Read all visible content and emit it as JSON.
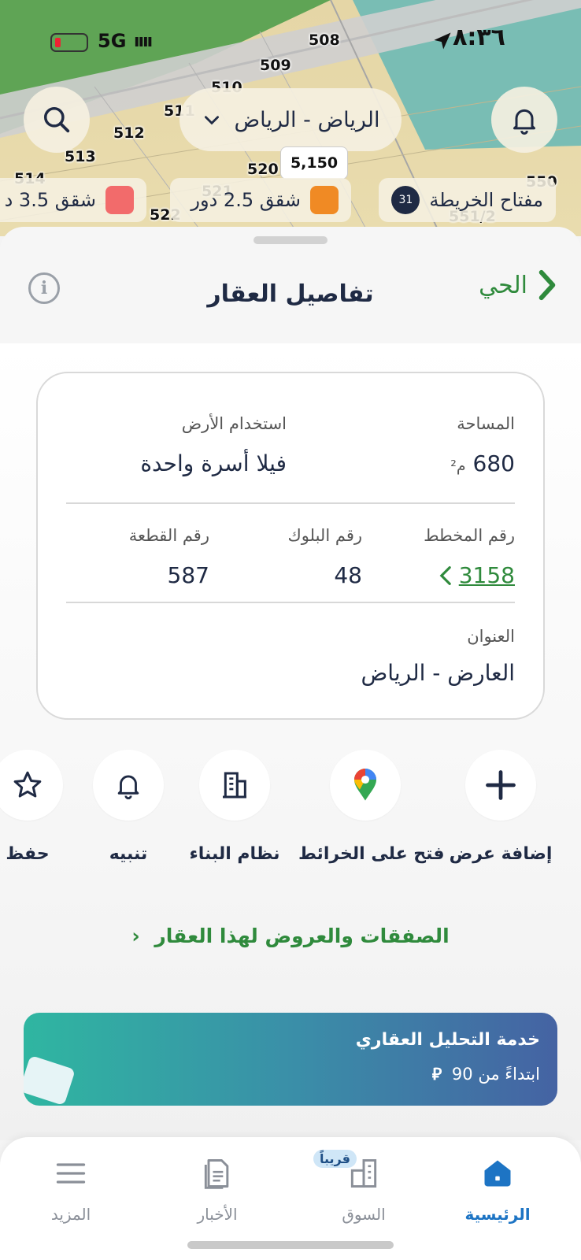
{
  "status_bar": {
    "time": "٨:٣٦",
    "network": "5G"
  },
  "map": {
    "plot_numbers": [
      "508",
      "509",
      "510",
      "511",
      "512",
      "513",
      "514",
      "520",
      "521",
      "522",
      "550",
      "551/2"
    ],
    "search_icon": "search-icon",
    "city_select": {
      "value": "الرياض - الرياض",
      "chevron": "chevron-down-icon"
    },
    "notifications_icon": "bell-icon",
    "price_tag": "5,150",
    "legend": {
      "key_label": "مفتاح الخريطة",
      "key_count": "31",
      "chips": [
        {
          "label": "شقق 2.5 دور",
          "color": "#f08a24"
        },
        {
          "label": "شقق 3.5 د",
          "color": "#f26b6b"
        }
      ]
    }
  },
  "sheet": {
    "title": "تفاصيل العقار",
    "back_label": "الحي",
    "card": {
      "area_label": "المساحة",
      "area_value": "680",
      "area_unit": "م²",
      "land_use_label": "استخدام الأرض",
      "land_use_value": "فيلا أسرة واحدة",
      "plan_label": "رقم المخطط",
      "plan_value": "3158",
      "block_label": "رقم البلوك",
      "block_value": "48",
      "plot_label": "رقم القطعة",
      "plot_value": "587",
      "address_label": "العنوان",
      "address_value": "العارض - الرياض"
    },
    "actions": [
      {
        "label": "إضافة عرض",
        "icon": "plus-icon"
      },
      {
        "label": "فتح على الخرائط",
        "icon": "map-pin-icon"
      },
      {
        "label": "نظام البناء",
        "icon": "building-icon"
      },
      {
        "label": "تنبيه",
        "icon": "bell-icon"
      },
      {
        "label": "حفظ",
        "icon": "star-icon"
      }
    ],
    "deals_link": "الصفقات والعروض لهذا العقار",
    "promo": {
      "title": "خدمة التحليل العقاري",
      "subtitle": "ابتداءً من 90"
    }
  },
  "bottom_nav": {
    "items": [
      {
        "label": "الرئيسية",
        "icon": "home-icon",
        "active": true
      },
      {
        "label": "السوق",
        "icon": "market-icon",
        "badge": "قريباً"
      },
      {
        "label": "الأخبار",
        "icon": "news-icon"
      },
      {
        "label": "المزيد",
        "icon": "menu-icon"
      }
    ]
  },
  "colors": {
    "accent_green": "#2f8a3c",
    "nav_active": "#1d74c4",
    "text_dark": "#1f2a44"
  }
}
